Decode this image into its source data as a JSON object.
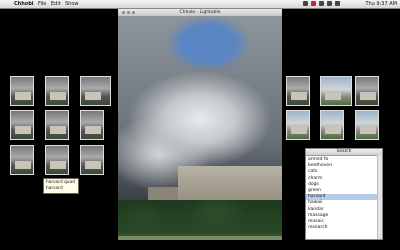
{
  "menubar": {
    "app_name": "Chhobi",
    "items": [
      "File",
      "Edit",
      "Show"
    ],
    "clock": "Thu 9:37 AM",
    "apple_symbol": ""
  },
  "window": {
    "title": "Chhobi - Lightable"
  },
  "tooltip": {
    "lines": [
      "harvard quad",
      "harvard"
    ]
  },
  "panel": {
    "title": "Search",
    "items": [
      "armed fo",
      "beethoven",
      "cats",
      "charm",
      "dogs",
      "green",
      "harvard",
      "hawaii",
      "kandar",
      "massage",
      "mosaic",
      "research"
    ],
    "selected_index": 6
  },
  "colors": {
    "selection": "#b6cde8",
    "menu_bg": "#e6e6e6"
  }
}
